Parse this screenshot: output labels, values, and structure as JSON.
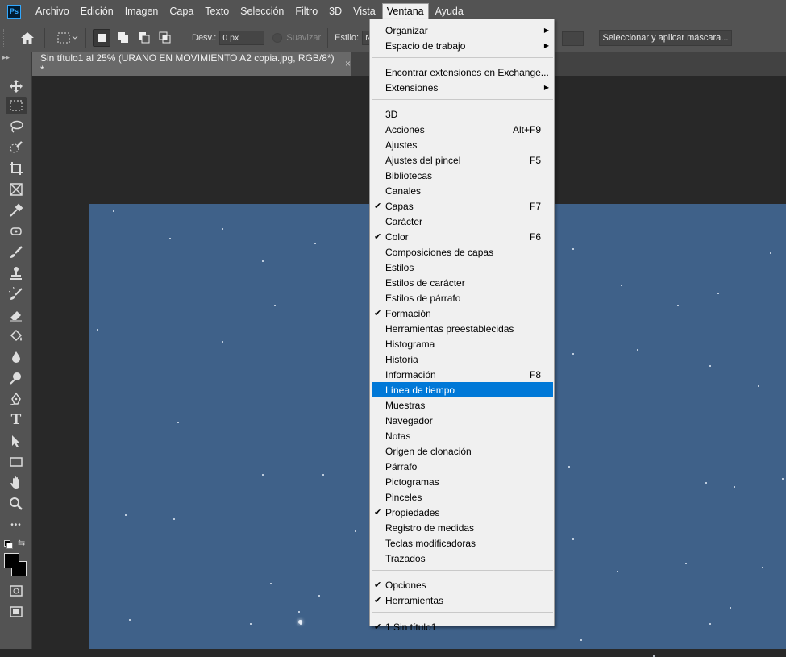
{
  "menubar": {
    "logo": "Ps",
    "items": [
      "Archivo",
      "Edición",
      "Imagen",
      "Capa",
      "Texto",
      "Selección",
      "Filtro",
      "3D",
      "Vista",
      "Ventana",
      "Ayuda"
    ]
  },
  "options": {
    "desv_label": "Desv.:",
    "desv_value": "0 px",
    "suavizar": "Suavizar",
    "estilo_label": "Estilo:",
    "estilo_value": "N",
    "mask_button": "Seleccionar y aplicar máscara..."
  },
  "document": {
    "tab_title": "Sin título1 al 25% (URANO EN MOVIMIENTO A2 copia.jpg, RGB/8*) *",
    "close": "×"
  },
  "toolbox": {
    "tools": [
      "move-tool",
      "marquee-tool",
      "lasso-tool",
      "quick-selection-tool",
      "crop-tool",
      "frame-tool",
      "eyedropper-tool",
      "spot-healing-tool",
      "brush-tool",
      "clone-stamp-tool",
      "history-brush-tool",
      "eraser-tool",
      "paint-bucket-tool",
      "blur-tool",
      "dodge-tool",
      "pen-tool",
      "type-tool",
      "path-selection-tool",
      "rectangle-tool",
      "hand-tool",
      "zoom-tool",
      "more-tools"
    ],
    "type_glyph": "T",
    "more_glyph": "•••",
    "colors": {
      "foreground": "#000000",
      "background": "#ffffff"
    }
  },
  "ventana_menu": {
    "groups": [
      [
        {
          "label": "Organizar",
          "submenu": true
        },
        {
          "label": "Espacio de trabajo",
          "submenu": true
        }
      ],
      [
        {
          "label": "Encontrar extensiones en Exchange..."
        },
        {
          "label": "Extensiones",
          "submenu": true
        }
      ],
      [
        {
          "label": "3D"
        },
        {
          "label": "Acciones",
          "shortcut": "Alt+F9"
        },
        {
          "label": "Ajustes"
        },
        {
          "label": "Ajustes del pincel",
          "shortcut": "F5"
        },
        {
          "label": "Bibliotecas"
        },
        {
          "label": "Canales"
        },
        {
          "label": "Capas",
          "shortcut": "F7",
          "checked": true
        },
        {
          "label": "Carácter"
        },
        {
          "label": "Color",
          "shortcut": "F6",
          "checked": true
        },
        {
          "label": "Composiciones de capas"
        },
        {
          "label": "Estilos"
        },
        {
          "label": "Estilos de carácter"
        },
        {
          "label": "Estilos de párrafo"
        },
        {
          "label": "Formación",
          "checked": true
        },
        {
          "label": "Herramientas preestablecidas"
        },
        {
          "label": "Histograma"
        },
        {
          "label": "Historia"
        },
        {
          "label": "Información",
          "shortcut": "F8"
        },
        {
          "label": "Línea de tiempo",
          "highlighted": true
        },
        {
          "label": "Muestras"
        },
        {
          "label": "Navegador"
        },
        {
          "label": "Notas"
        },
        {
          "label": "Origen de clonación"
        },
        {
          "label": "Párrafo"
        },
        {
          "label": "Pictogramas"
        },
        {
          "label": "Pinceles"
        },
        {
          "label": "Propiedades",
          "checked": true
        },
        {
          "label": "Registro de medidas"
        },
        {
          "label": "Teclas modificadoras"
        },
        {
          "label": "Trazados"
        }
      ],
      [
        {
          "label": "Opciones",
          "checked": true
        },
        {
          "label": "Herramientas",
          "checked": true
        }
      ],
      [
        {
          "label": "1 Sin título1",
          "checked": true
        }
      ]
    ],
    "checkmark": "✔",
    "submenu_arrow": "▶"
  },
  "colors": {
    "menu_highlight": "#0078d7",
    "canvas_sky": "#3f6189",
    "panel": "#535353"
  }
}
